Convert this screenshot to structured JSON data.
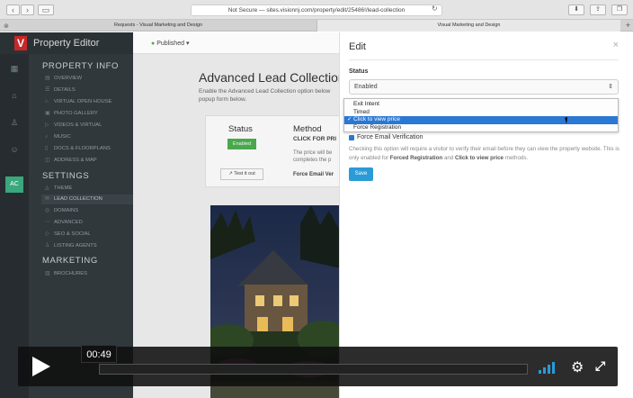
{
  "browser": {
    "back": "‹",
    "forward": "›",
    "url": "Not Secure — sites.visionnj.com/property/edit/25486!/lead-collection",
    "tabs": [
      {
        "label": "Requests - Visual Marketing and Design"
      },
      {
        "label": "Visual Marketing and Design"
      }
    ]
  },
  "app": {
    "logo": "V",
    "title": "Property Editor",
    "status": "Published",
    "rail_badge": "AC"
  },
  "sidebar": {
    "sections": [
      {
        "heading": "PROPERTY INFO"
      },
      {
        "heading": "SETTINGS"
      },
      {
        "heading": "MARKETING"
      }
    ],
    "items": [
      {
        "label": "OVERVIEW"
      },
      {
        "label": "DETAILS"
      },
      {
        "label": "VIRTUAL OPEN HOUSE"
      },
      {
        "label": "PHOTO GALLERY"
      },
      {
        "label": "VIDEOS & VIRTUAL"
      },
      {
        "label": "MUSIC"
      },
      {
        "label": "DOCS & FLOORPLANS"
      },
      {
        "label": "ADDRESS & MAP"
      },
      {
        "label": "THEME"
      },
      {
        "label": "LEAD COLLECTION"
      },
      {
        "label": "DOMAINS"
      },
      {
        "label": "ADVANCED"
      },
      {
        "label": "SEO & SOCIAL"
      },
      {
        "label": "LISTING AGENTS"
      },
      {
        "label": "BROCHURES"
      }
    ]
  },
  "main": {
    "title": "Advanced Lead Collection",
    "description": "Enable the Advanced Lead Collection option below popup form below.",
    "status_card": {
      "title": "Status",
      "badge": "Enabled",
      "test_button": "Test it out"
    },
    "method_card": {
      "title": "Method",
      "subtitle": "CLICK FOR PRI",
      "text": "The price will be completes the p",
      "required": "Force Email Ver"
    }
  },
  "edit_panel": {
    "title": "Edit",
    "close": "×",
    "status_label": "Status",
    "status_value": "Enabled",
    "dropdown_options": [
      {
        "label": "Exit Intent",
        "selected": false
      },
      {
        "label": "Timed",
        "selected": false
      },
      {
        "label": "Click to view price",
        "selected": true
      },
      {
        "label": "Force Registration",
        "selected": false
      }
    ],
    "checkbox_label": "Force Email Verification",
    "help_prefix": "Checking this option will require a visitor to verify their email before they can view the property website. This is only enabled for ",
    "help_bold_1": "Forced Registration",
    "help_mid": " and ",
    "help_bold_2": "Click to view price",
    "help_suffix": " methods.",
    "save_button": "Save"
  },
  "player": {
    "time": "00:49",
    "accent": "#2a9bd6"
  }
}
